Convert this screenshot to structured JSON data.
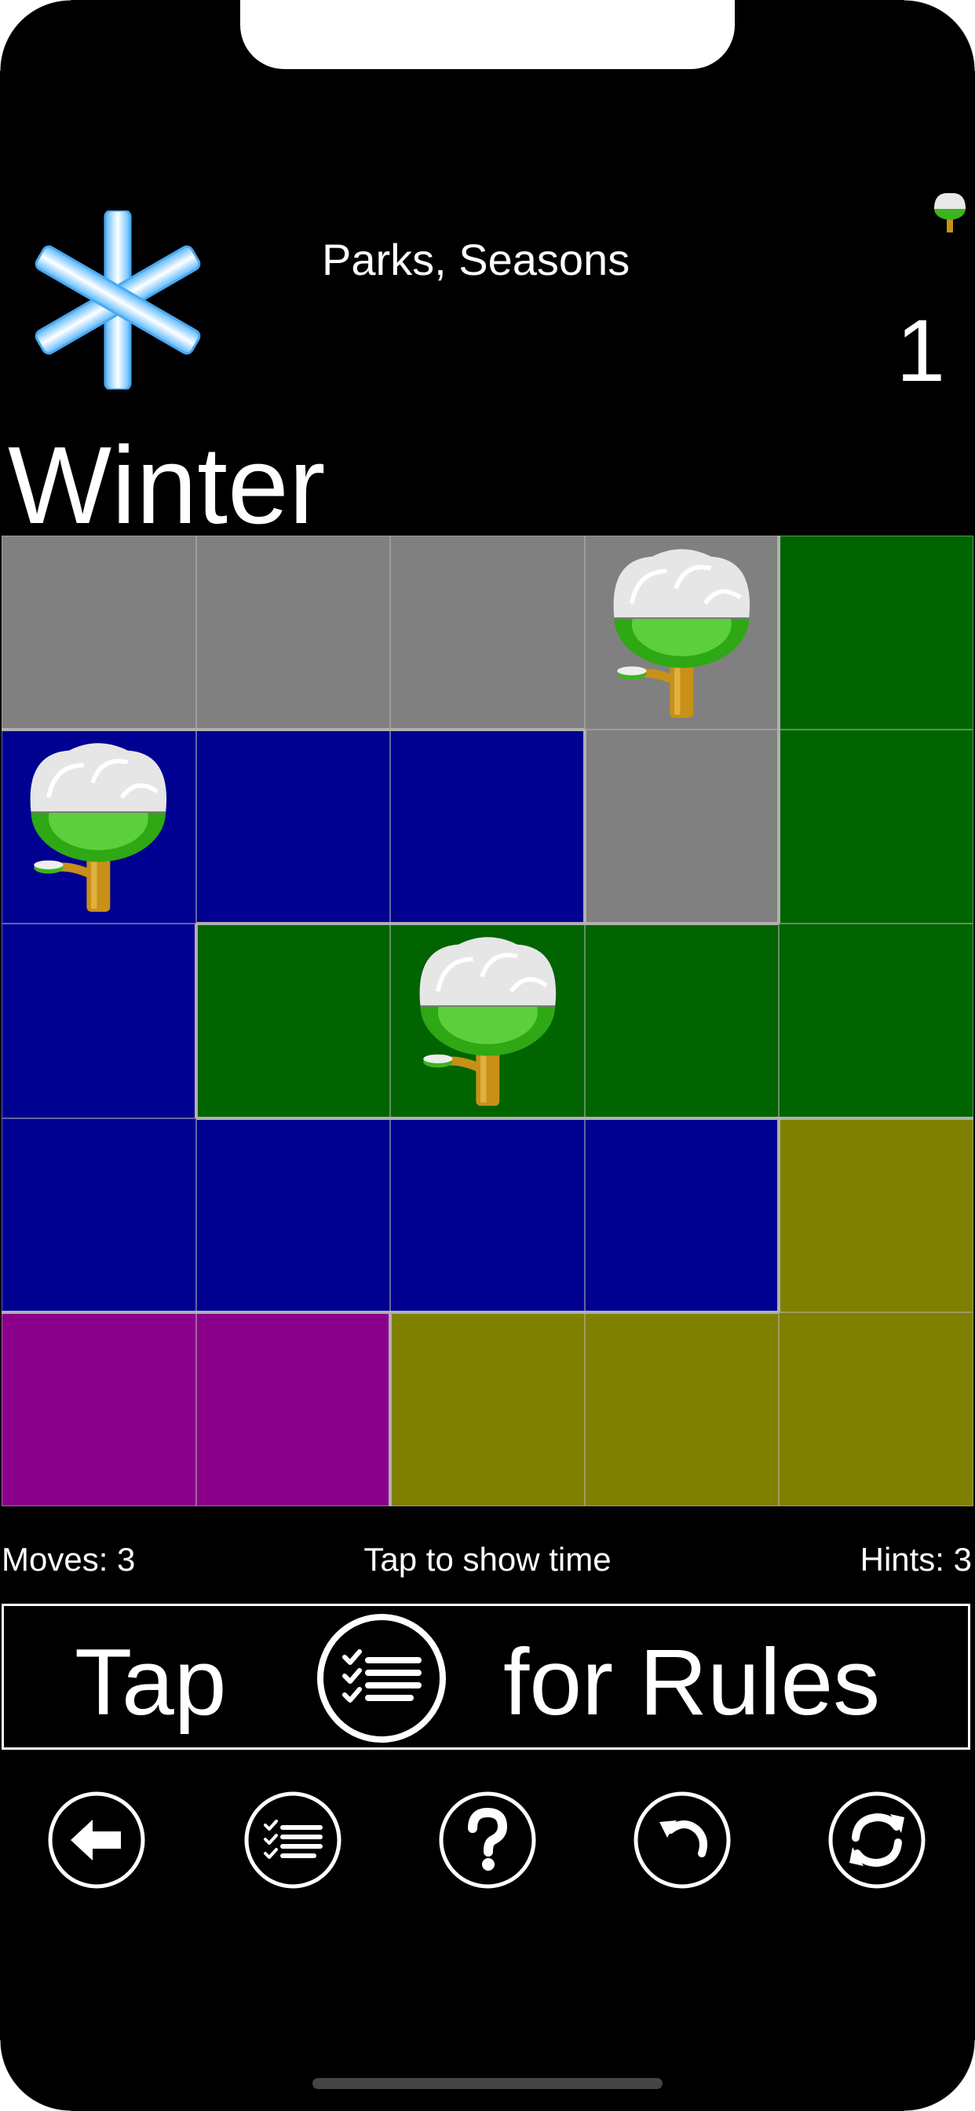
{
  "header": {
    "collection_title": "Parks, Seasons",
    "level_number": "1",
    "level_name": "Winter",
    "season_icon": "snowflake-icon",
    "count_icon": "snowy-tree-icon"
  },
  "board": {
    "rows": 5,
    "cols": 5,
    "colors": {
      "gray": "#808080",
      "blue": "#000091",
      "green": "#006400",
      "olive": "#808000",
      "purple": "#8B008B"
    },
    "grid": [
      [
        "gray",
        "gray",
        "gray",
        "gray",
        "green"
      ],
      [
        "blue",
        "blue",
        "blue",
        "gray",
        "green"
      ],
      [
        "blue",
        "green",
        "green",
        "green",
        "green"
      ],
      [
        "blue",
        "blue",
        "blue",
        "blue",
        "olive"
      ],
      [
        "purple",
        "purple",
        "olive",
        "olive",
        "olive"
      ]
    ],
    "trees": [
      {
        "row": 0,
        "col": 3
      },
      {
        "row": 1,
        "col": 0
      },
      {
        "row": 2,
        "col": 2
      }
    ],
    "tree_icon": "snowy-tree-icon"
  },
  "status": {
    "moves": "Moves: 3",
    "timer": "Tap to show time",
    "hints": "Hints: 3"
  },
  "rules_banner": {
    "tap": "Tap",
    "text": "for Rules",
    "icon": "checklist-icon"
  },
  "toolbar": [
    {
      "icon": "back-arrow-icon"
    },
    {
      "icon": "checklist-icon"
    },
    {
      "icon": "help-icon"
    },
    {
      "icon": "undo-icon"
    },
    {
      "icon": "restart-icon"
    }
  ]
}
